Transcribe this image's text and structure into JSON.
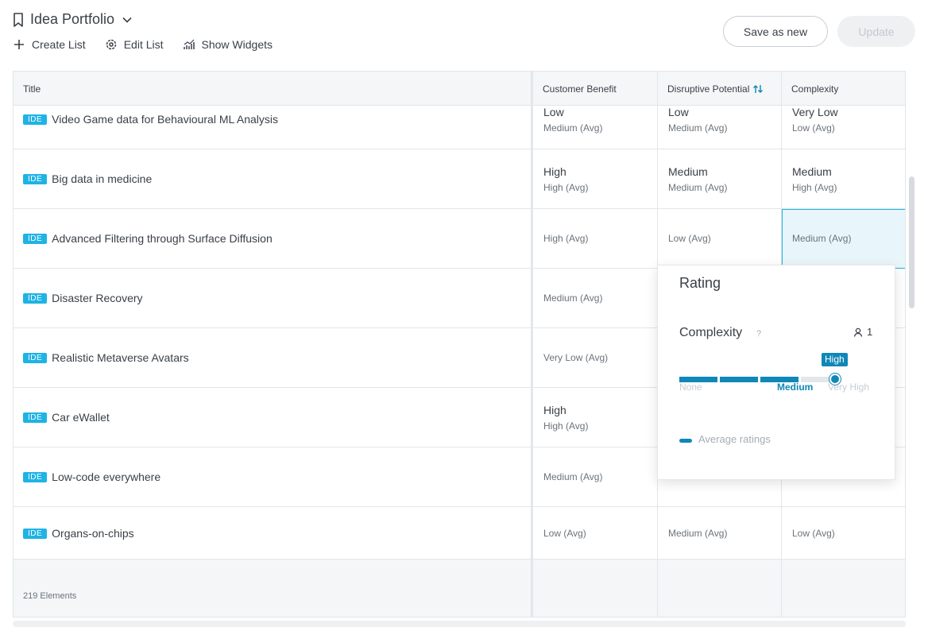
{
  "header": {
    "title": "Idea Portfolio",
    "toolbar": {
      "create_list": "Create List",
      "edit_list": "Edit List",
      "show_widgets": "Show Widgets"
    },
    "save_as_new": "Save as new",
    "update": "Update"
  },
  "table": {
    "columns": {
      "title": "Title",
      "customer_benefit": "Customer Benefit",
      "disruptive_potential": "Disruptive Potential",
      "complexity": "Complexity"
    },
    "sort_icon": "sort-updown-icon",
    "rows": [
      {
        "tag": "IDE",
        "title": "Video Game data for Behavioural ML Analysis",
        "cb_main": "Low",
        "cb_avg": "Medium (Avg)",
        "dp_main": "Low",
        "dp_avg": "Medium (Avg)",
        "cx_main": "Very Low",
        "cx_avg": "Low (Avg)"
      },
      {
        "tag": "IDE",
        "title": "Big data in medicine",
        "cb_main": "High",
        "cb_avg": "High (Avg)",
        "dp_main": "Medium",
        "dp_avg": "Medium (Avg)",
        "cx_main": "Medium",
        "cx_avg": "High (Avg)"
      },
      {
        "tag": "IDE",
        "title": "Advanced Filtering through Surface Diffusion",
        "cb_avg": "High (Avg)",
        "dp_avg": "Low (Avg)",
        "cx_avg": "Medium (Avg)"
      },
      {
        "tag": "IDE",
        "title": "Disaster Recovery",
        "cb_avg": "Medium (Avg)"
      },
      {
        "tag": "IDE",
        "title": "Realistic Metaverse Avatars",
        "cb_avg": "Very Low (Avg)"
      },
      {
        "tag": "IDE",
        "title": "Car eWallet",
        "cb_main": "High",
        "cb_avg": "High (Avg)"
      },
      {
        "tag": "IDE",
        "title": "Low-code everywhere",
        "cb_avg": "Medium (Avg)"
      },
      {
        "tag": "IDE",
        "title": "Organs-on-chips",
        "cb_avg": "Low (Avg)",
        "dp_avg": "Medium (Avg)",
        "cx_avg": "Low (Avg)"
      }
    ],
    "footer_count": "219 Elements"
  },
  "rating_popup": {
    "heading": "Rating",
    "criterion": "Complexity",
    "help": "?",
    "user_count": "1",
    "selected_label": "High",
    "scale": {
      "none": "None",
      "medium": "Medium",
      "very_high": "Very High"
    },
    "selected_level": 4,
    "scale_max": 5,
    "legend": "Average ratings",
    "accent_color": "#0f87b8"
  },
  "colors": {
    "tag": "#1fb3e4",
    "accent": "#0f87b8",
    "selected_cell_bg": "#e8f6fb"
  }
}
